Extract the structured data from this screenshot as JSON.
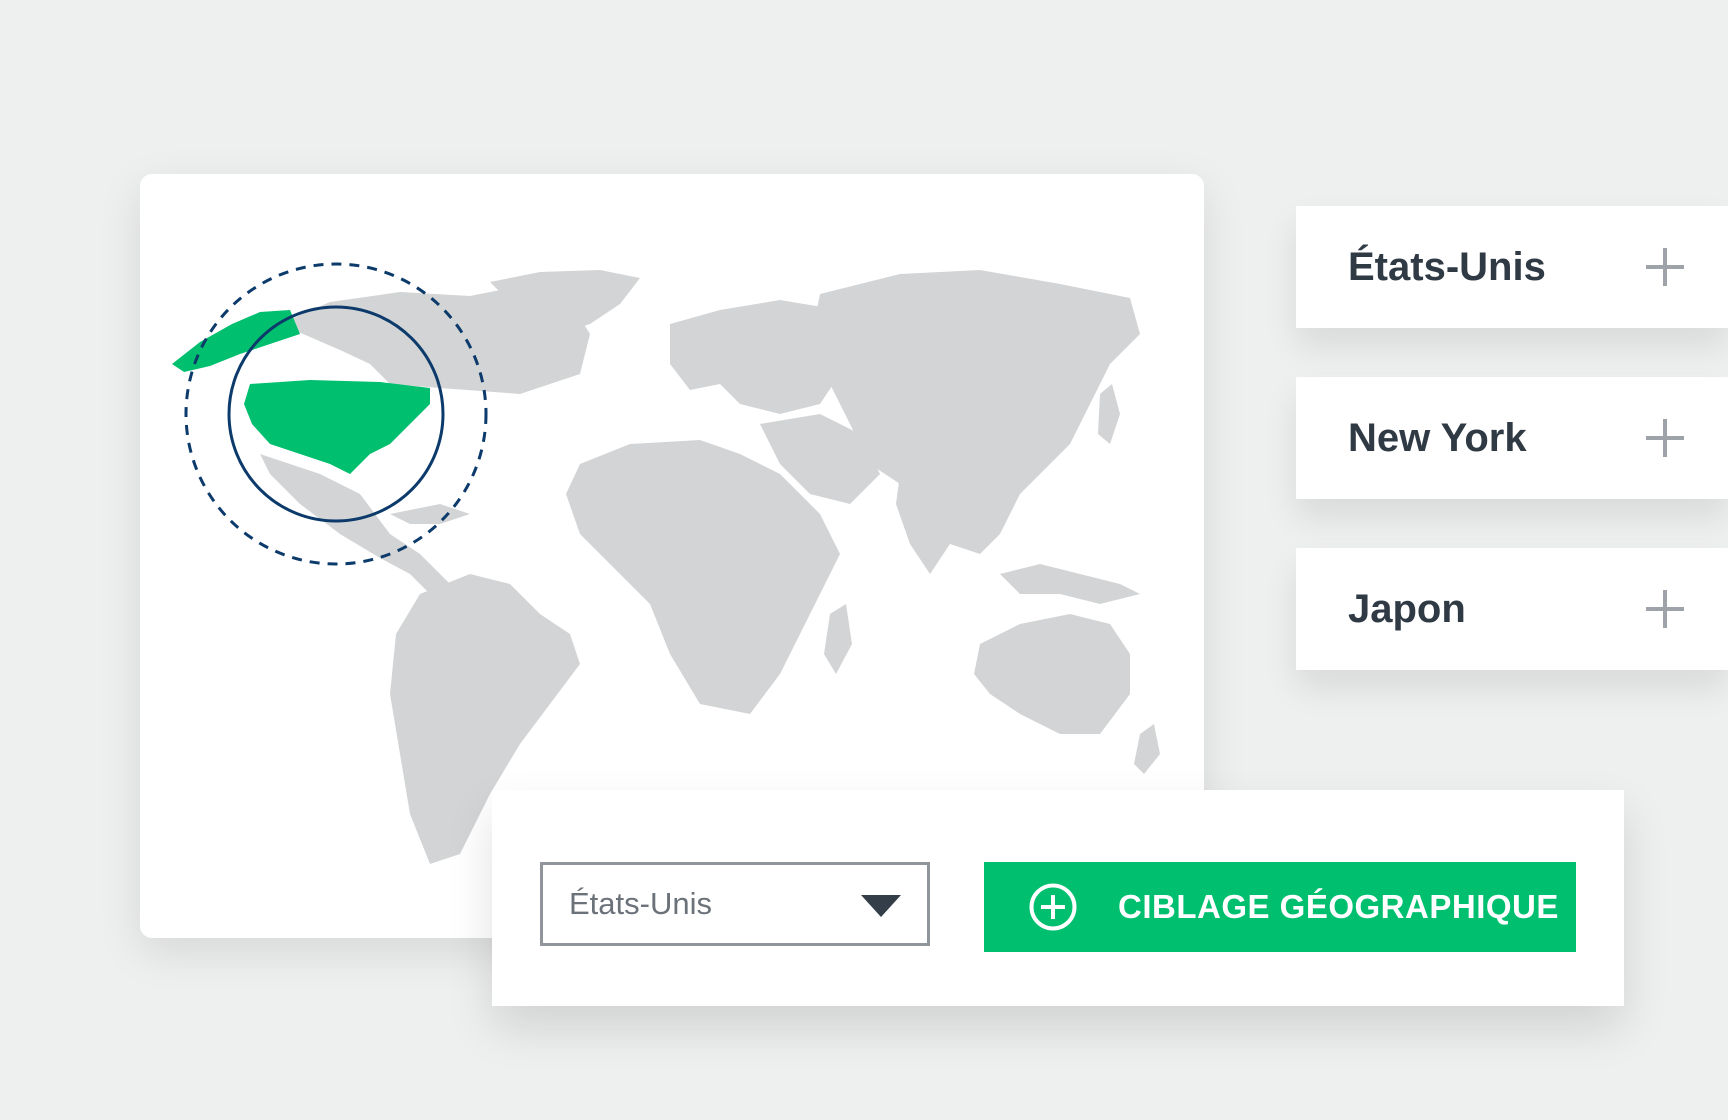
{
  "map": {
    "highlighted_region": "États-Unis",
    "colors": {
      "land": "#d3d4d5",
      "highlight": "#00bf6f",
      "ring": "#0b3a6b"
    }
  },
  "locations": [
    {
      "label": "États-Unis",
      "action_icon": "plus-icon"
    },
    {
      "label": "New York",
      "action_icon": "plus-icon"
    },
    {
      "label": "Japon",
      "action_icon": "plus-icon"
    }
  ],
  "targeting": {
    "selected_country": "États-Unis",
    "button_label": "CIBLAGE GÉOGRAPHIQUE",
    "button_icon": "plus-circle-icon",
    "button_color": "#00bf6f"
  }
}
